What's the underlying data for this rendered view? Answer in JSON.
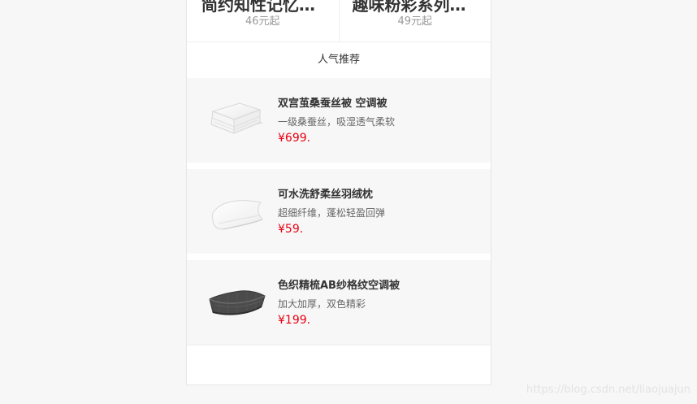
{
  "top_cards": [
    {
      "title": "简约知性记忆…",
      "price": "46元起"
    },
    {
      "title": "趣味粉彩系列…",
      "price": "49元起"
    }
  ],
  "section_title": "人气推荐",
  "products": [
    {
      "title": "双宫茧桑蚕丝被 空调被",
      "description": "一级桑蚕丝，吸湿透气柔软",
      "price": "¥699.",
      "image_icon": "white-silk-quilt-image"
    },
    {
      "title": "可水洗舒柔丝羽绒枕",
      "description": "超细纤维，蓬松轻盈回弹",
      "price": "¥59.",
      "image_icon": "white-pillow-image"
    },
    {
      "title": "色织精梳AB纱格纹空调被",
      "description": "加大加厚，双色精彩",
      "price": "¥199.",
      "image_icon": "gray-blanket-image"
    }
  ],
  "watermark": "https://blog.csdn.net/liaojuajun",
  "colors": {
    "background": "#f7f7f7",
    "price": "#e60012",
    "text": "#333333",
    "muted": "#999999"
  }
}
